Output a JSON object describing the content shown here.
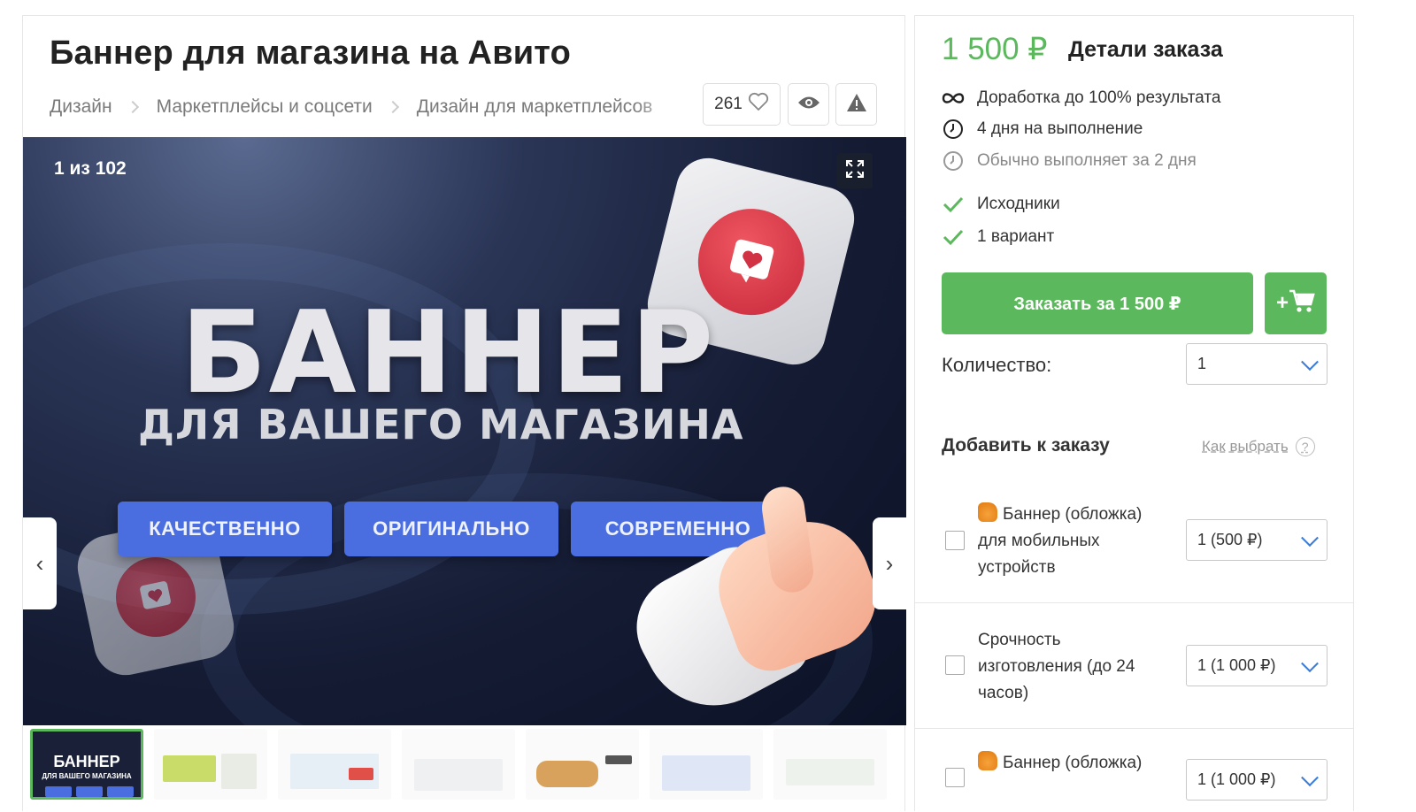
{
  "gig": {
    "title": "Баннер для магазина на Авито",
    "breadcrumbs": [
      "Дизайн",
      "Маркетплейсы и соцсети",
      "Дизайн для маркетплейсов"
    ],
    "likes": "261"
  },
  "gallery": {
    "counter": "1 из 102",
    "banner_title": "БАННЕР",
    "banner_subtitle": "ДЛЯ ВАШЕГО МАГАЗИНА",
    "pills": [
      "КАЧЕСТВЕННО",
      "ОРИГИНАЛЬНО",
      "СОВРЕМЕННО"
    ],
    "thumb_active_title": "БАННЕР",
    "thumb_active_sub": "ДЛЯ ВАШЕГО МАГАЗИНА",
    "thumb_count_visible": 7
  },
  "order_panel": {
    "price": "1 500 ₽",
    "title": "Детали заказа",
    "features": [
      {
        "icon": "infinity-icon",
        "text": "Доработка до 100% результата"
      },
      {
        "icon": "clock-icon",
        "text": "4 дня на выполнение"
      },
      {
        "icon": "clock-icon",
        "text": "Обычно выполняет за 2 дня"
      },
      {
        "icon": "check-icon",
        "text": "Исходники"
      },
      {
        "icon": "check-icon",
        "text": "1 вариант"
      }
    ],
    "order_button": "Заказать за 1 500 ₽",
    "cart_button": "+",
    "quantity_label": "Количество:",
    "quantity_value": "1",
    "addons_title": "Добавить к заказу",
    "how_to_choose": "Как выбрать",
    "addons": [
      {
        "label": "Баннер (обложка) для мобильных устройств",
        "select": "1 (500 ₽)",
        "badge": "thumbs-up-icon"
      },
      {
        "label": "Срочность изготовления (до 24 часов)",
        "select": "1 (1 000 ₽)"
      },
      {
        "label": "Баннер (обложка)",
        "select": "1 (1 000 ₽)",
        "badge": "thumbs-up-icon"
      }
    ]
  },
  "colors": {
    "accent_green": "#5cb85c",
    "link_blue": "#3b7dd8",
    "pill_blue": "#4a6ee0"
  }
}
